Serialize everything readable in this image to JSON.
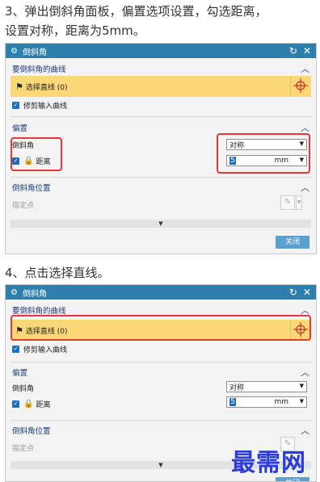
{
  "steps": {
    "s3_line1": "3、弹出倒斜角面板，偏置选项设置，勾选距离，",
    "s3_line2": "设置对称，距离为5mm。",
    "s4": "4、点击选择直线。"
  },
  "dialog": {
    "title": "倒斜角",
    "sections": {
      "curves": "要倒斜角的曲线",
      "offset": "偏置",
      "position": "倒斜角位置"
    },
    "select_curve": "选择直线 (0)",
    "trim_input": "修剪输入曲线",
    "chamfer_label": "倒斜角",
    "distance_label": "距离",
    "mode_value": "对称",
    "distance_value": "5",
    "unit": "mm",
    "specify_point": "指定点",
    "close_label": "关闭"
  },
  "watermark": "最需网",
  "colors": {
    "title_bar": "#2d7fae",
    "highlight": "#fbd877",
    "annotation": "#e23a3a",
    "watermark": "#2a3bd8"
  }
}
